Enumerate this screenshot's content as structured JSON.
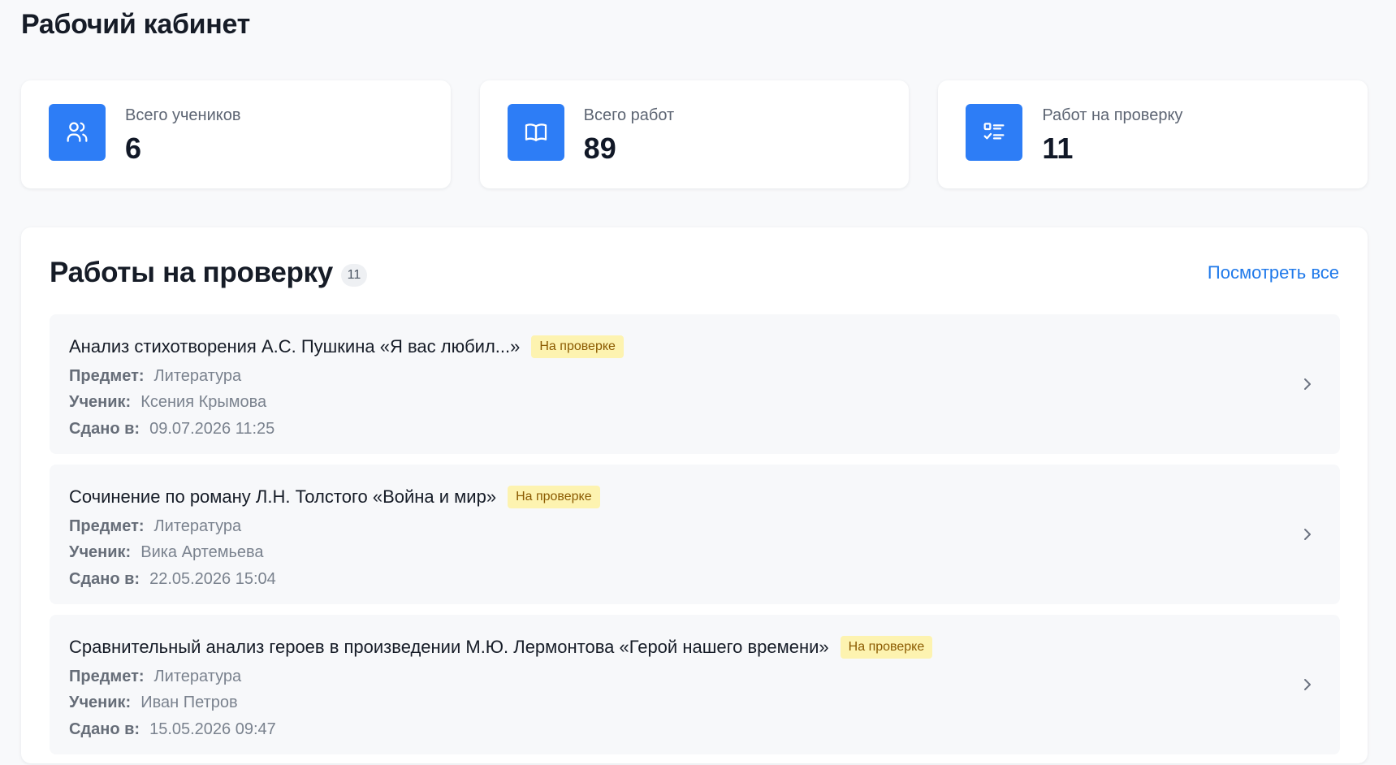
{
  "page": {
    "title": "Рабочий кабинет"
  },
  "stats": [
    {
      "label": "Всего учеников",
      "value": "6",
      "icon": "users-icon"
    },
    {
      "label": "Всего работ",
      "value": "89",
      "icon": "book-open-icon"
    },
    {
      "label": "Работ на проверку",
      "value": "11",
      "icon": "checklist-icon"
    }
  ],
  "review_panel": {
    "title": "Работы на проверку",
    "count": "11",
    "view_all_label": "Посмотреть все",
    "labels": {
      "subject": "Предмет:",
      "student": "Ученик:",
      "submitted": "Сдано в:"
    },
    "items": [
      {
        "title": "Анализ стихотворения А.С. Пушкина «Я вас любил...»",
        "status": "На проверке",
        "subject": "Литература",
        "student": "Ксения Крымова",
        "submitted": "09.07.2026 11:25"
      },
      {
        "title": "Сочинение по роману Л.Н. Толстого «Война и мир»",
        "status": "На проверке",
        "subject": "Литература",
        "student": "Вика Артемьева",
        "submitted": "22.05.2026 15:04"
      },
      {
        "title": "Сравнительный анализ героев в произведении М.Ю. Лермонтова «Герой нашего времени»",
        "status": "На проверке",
        "subject": "Литература",
        "student": "Иван Петров",
        "submitted": "15.05.2026 09:47"
      }
    ]
  },
  "colors": {
    "accent": "#2d7df6",
    "link": "#1f79ea",
    "status_badge_bg": "#fdf3b0",
    "status_badge_text": "#8b5a00",
    "page_bg": "#f8f9fb",
    "card_bg": "#ffffff"
  }
}
